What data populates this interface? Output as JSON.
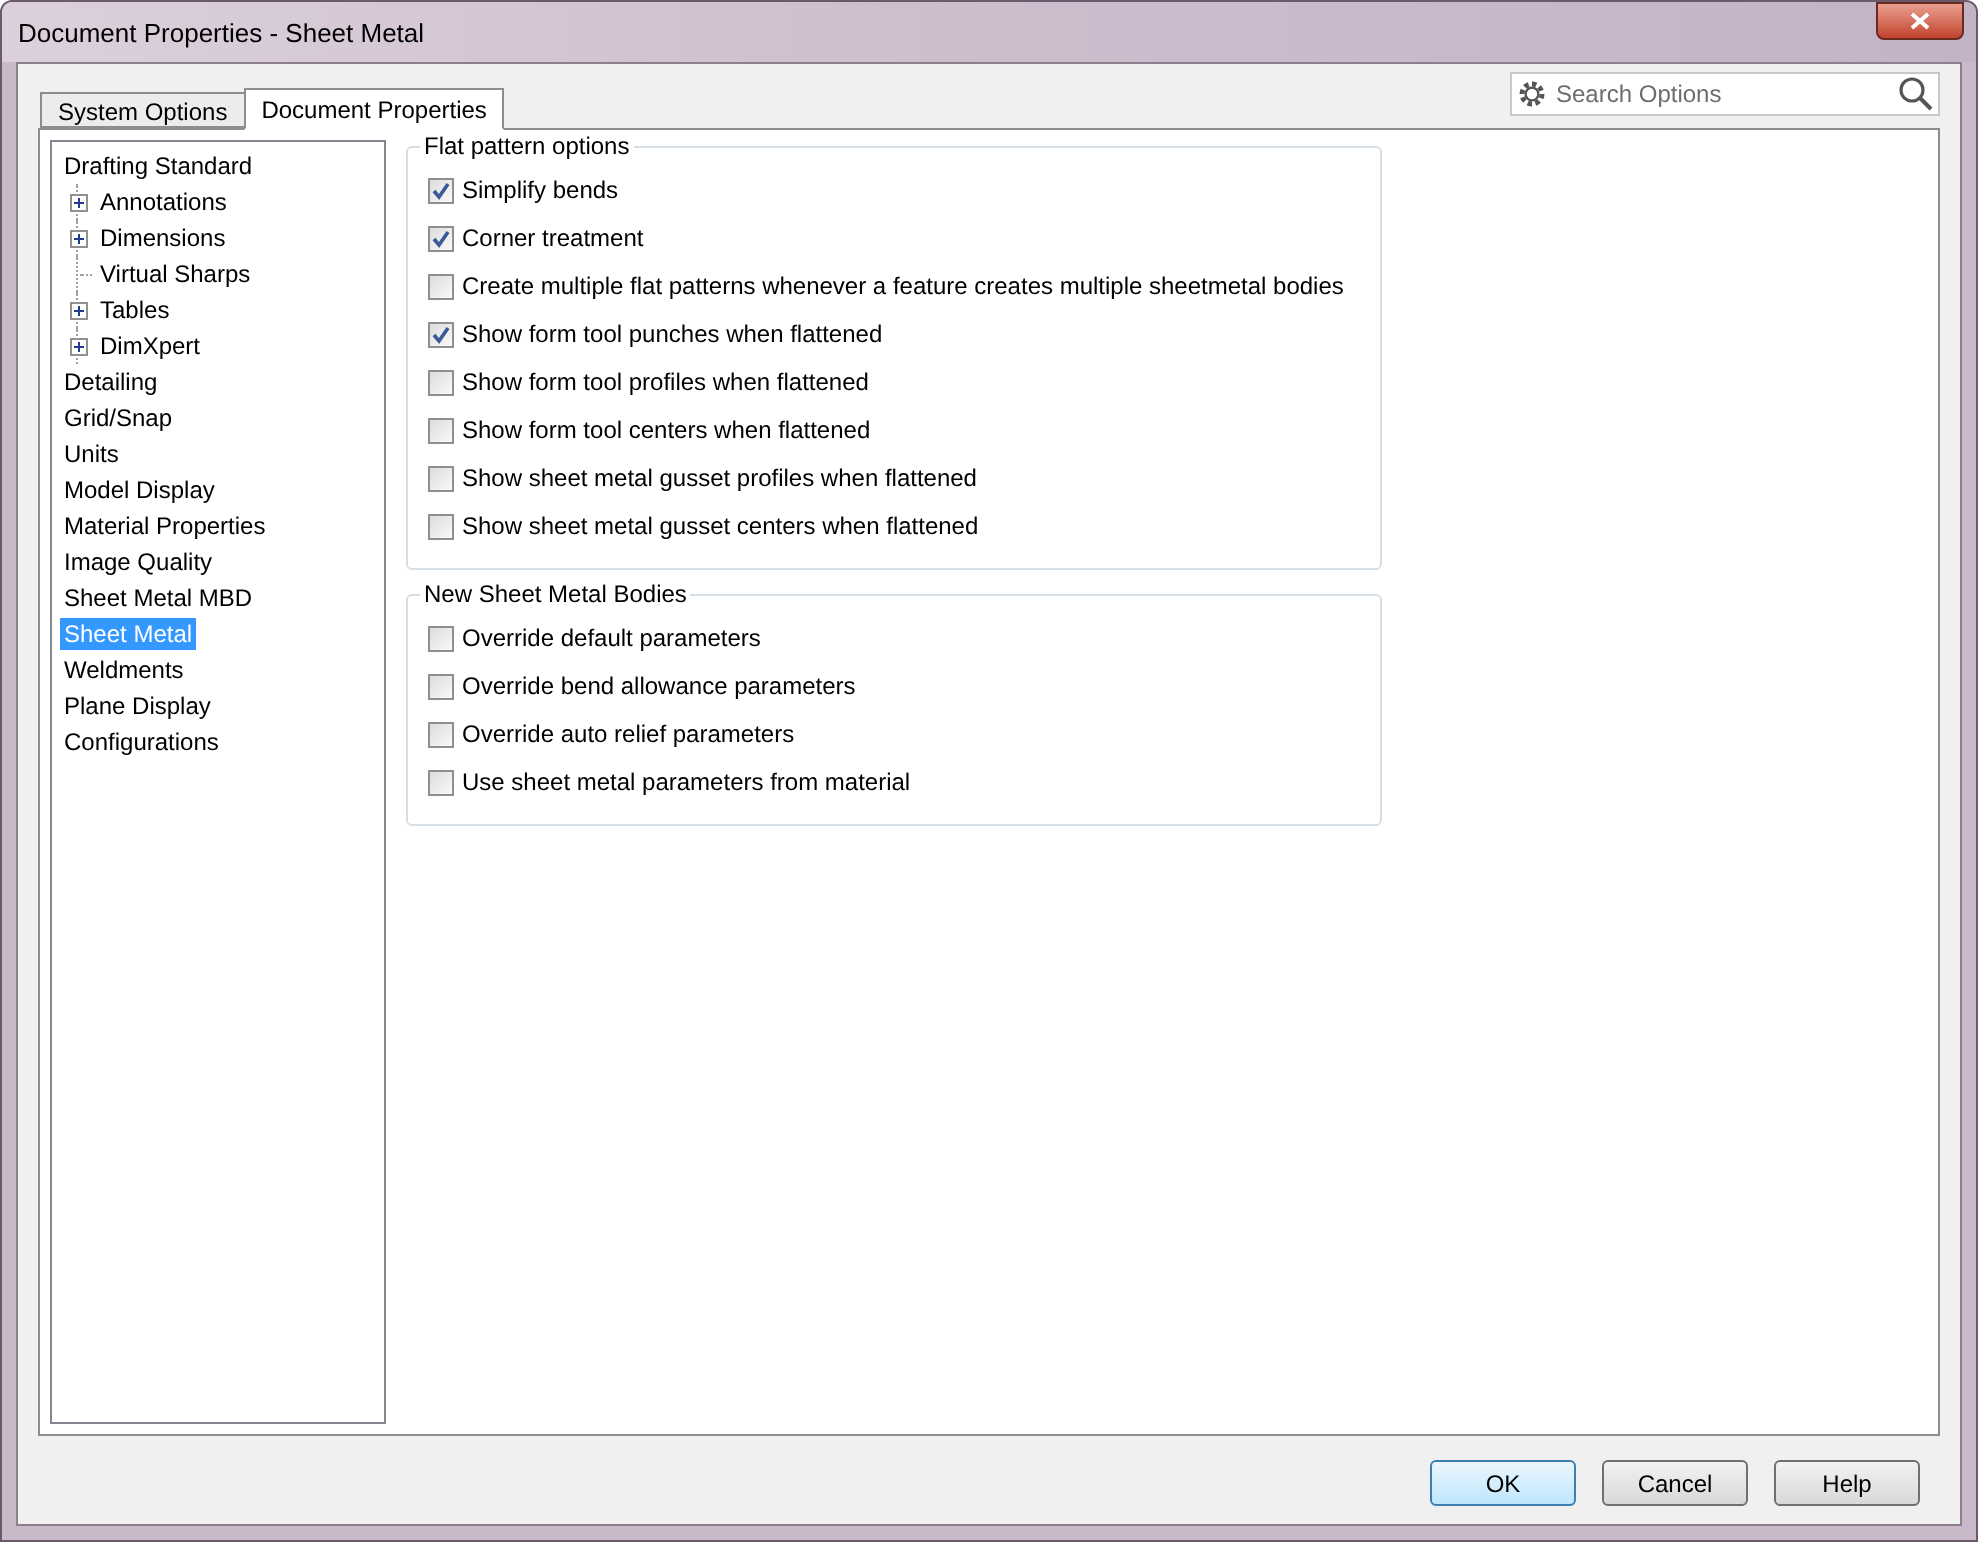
{
  "window": {
    "title": "Document Properties - Sheet Metal"
  },
  "tabs": [
    {
      "label": "System Options",
      "selected": false
    },
    {
      "label": "Document Properties",
      "selected": true
    }
  ],
  "search": {
    "placeholder": "Search Options"
  },
  "tree": [
    {
      "label": "Drafting Standard",
      "selected": false,
      "children": [
        {
          "label": "Annotations",
          "expanded": false,
          "selected": false
        },
        {
          "label": "Dimensions",
          "expanded": false,
          "selected": false
        },
        {
          "label": "Virtual Sharps",
          "selected": false
        },
        {
          "label": "Tables",
          "expanded": false,
          "selected": false
        },
        {
          "label": "DimXpert",
          "expanded": false,
          "selected": false
        }
      ]
    },
    {
      "label": "Detailing",
      "selected": false
    },
    {
      "label": "Grid/Snap",
      "selected": false
    },
    {
      "label": "Units",
      "selected": false
    },
    {
      "label": "Model Display",
      "selected": false
    },
    {
      "label": "Material Properties",
      "selected": false
    },
    {
      "label": "Image Quality",
      "selected": false
    },
    {
      "label": "Sheet Metal MBD",
      "selected": false
    },
    {
      "label": "Sheet Metal",
      "selected": true
    },
    {
      "label": "Weldments",
      "selected": false
    },
    {
      "label": "Plane Display",
      "selected": false
    },
    {
      "label": "Configurations",
      "selected": false
    }
  ],
  "groups": [
    {
      "title": "Flat pattern options",
      "options": [
        {
          "label": "Simplify bends",
          "checked": true
        },
        {
          "label": "Corner treatment",
          "checked": true
        },
        {
          "label": "Create multiple flat patterns whenever a feature creates multiple sheetmetal bodies",
          "checked": false
        },
        {
          "label": "Show form tool punches when flattened",
          "checked": true
        },
        {
          "label": "Show form tool profiles when flattened",
          "checked": false
        },
        {
          "label": "Show form tool centers when flattened",
          "checked": false
        },
        {
          "label": "Show sheet metal gusset profiles when flattened",
          "checked": false
        },
        {
          "label": "Show sheet metal gusset centers when flattened",
          "checked": false
        }
      ]
    },
    {
      "title": "New Sheet Metal Bodies",
      "options": [
        {
          "label": "Override default parameters",
          "checked": false
        },
        {
          "label": "Override bend allowance parameters",
          "checked": false
        },
        {
          "label": "Override auto relief parameters",
          "checked": false
        },
        {
          "label": "Use sheet metal parameters from material",
          "checked": false
        }
      ]
    }
  ],
  "buttons": [
    {
      "label": "OK",
      "default": true
    },
    {
      "label": "Cancel",
      "default": false
    },
    {
      "label": "Help",
      "default": false
    }
  ]
}
